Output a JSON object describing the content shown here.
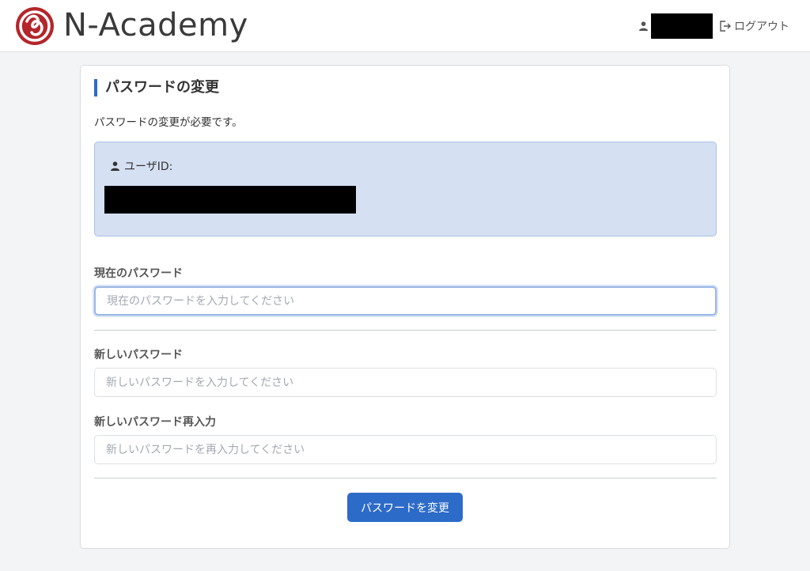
{
  "header": {
    "brand": "N-Academy",
    "logout_label": "ログアウト"
  },
  "card": {
    "title": "パスワードの変更",
    "description": "パスワードの変更が必要です。",
    "userid_label": "ユーザID:"
  },
  "form": {
    "current_password": {
      "label": "現在のパスワード",
      "placeholder": "現在のパスワードを入力してください",
      "value": ""
    },
    "new_password": {
      "label": "新しいパスワード",
      "placeholder": "新しいパスワードを入力してください",
      "value": ""
    },
    "confirm_password": {
      "label": "新しいパスワード再入力",
      "placeholder": "新しいパスワードを再入力してください",
      "value": ""
    },
    "submit_label": "パスワードを変更"
  },
  "colors": {
    "accent": "#2d6bc9",
    "logo_red": "#b3262b",
    "info_bg": "#d5e0f2"
  }
}
